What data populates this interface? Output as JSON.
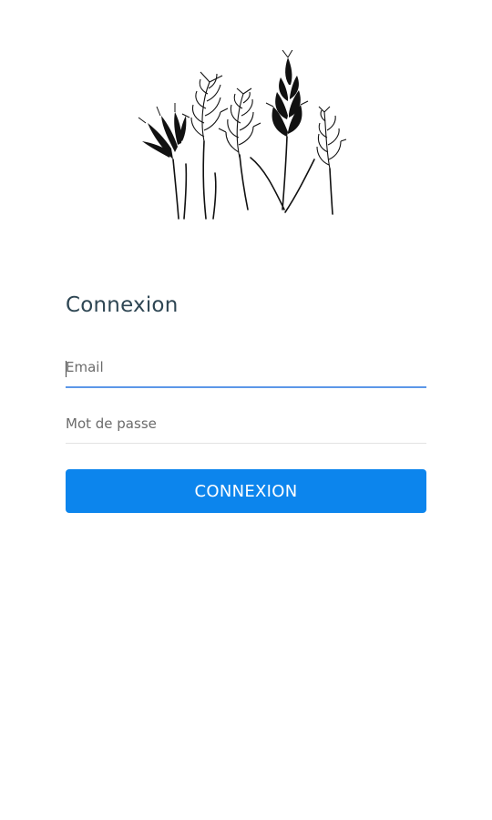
{
  "logo": {
    "icon": "wheat-stalks-illustration"
  },
  "login": {
    "title": "Connexion",
    "email_placeholder": "Email",
    "email_value": "",
    "password_placeholder": "Mot de passe",
    "password_value": "",
    "submit_label": "CONNEXION"
  },
  "colors": {
    "accent": "#0c85ed",
    "focus_underline": "#5c97e8",
    "title": "#2e4653"
  }
}
